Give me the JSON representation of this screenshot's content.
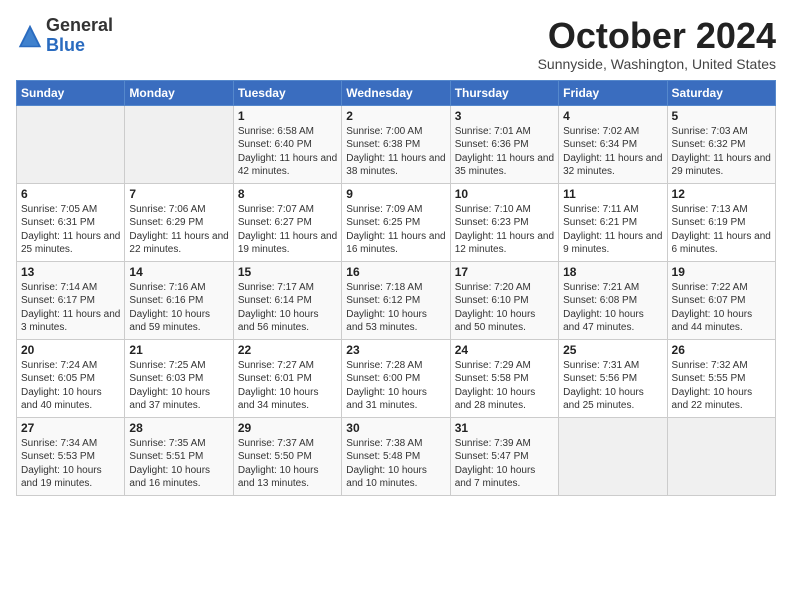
{
  "header": {
    "logo_general": "General",
    "logo_blue": "Blue",
    "month_title": "October 2024",
    "subtitle": "Sunnyside, Washington, United States"
  },
  "days_of_week": [
    "Sunday",
    "Monday",
    "Tuesday",
    "Wednesday",
    "Thursday",
    "Friday",
    "Saturday"
  ],
  "weeks": [
    [
      {
        "day": "",
        "info": ""
      },
      {
        "day": "",
        "info": ""
      },
      {
        "day": "1",
        "info": "Sunrise: 6:58 AM\nSunset: 6:40 PM\nDaylight: 11 hours and 42 minutes."
      },
      {
        "day": "2",
        "info": "Sunrise: 7:00 AM\nSunset: 6:38 PM\nDaylight: 11 hours and 38 minutes."
      },
      {
        "day": "3",
        "info": "Sunrise: 7:01 AM\nSunset: 6:36 PM\nDaylight: 11 hours and 35 minutes."
      },
      {
        "day": "4",
        "info": "Sunrise: 7:02 AM\nSunset: 6:34 PM\nDaylight: 11 hours and 32 minutes."
      },
      {
        "day": "5",
        "info": "Sunrise: 7:03 AM\nSunset: 6:32 PM\nDaylight: 11 hours and 29 minutes."
      }
    ],
    [
      {
        "day": "6",
        "info": "Sunrise: 7:05 AM\nSunset: 6:31 PM\nDaylight: 11 hours and 25 minutes."
      },
      {
        "day": "7",
        "info": "Sunrise: 7:06 AM\nSunset: 6:29 PM\nDaylight: 11 hours and 22 minutes."
      },
      {
        "day": "8",
        "info": "Sunrise: 7:07 AM\nSunset: 6:27 PM\nDaylight: 11 hours and 19 minutes."
      },
      {
        "day": "9",
        "info": "Sunrise: 7:09 AM\nSunset: 6:25 PM\nDaylight: 11 hours and 16 minutes."
      },
      {
        "day": "10",
        "info": "Sunrise: 7:10 AM\nSunset: 6:23 PM\nDaylight: 11 hours and 12 minutes."
      },
      {
        "day": "11",
        "info": "Sunrise: 7:11 AM\nSunset: 6:21 PM\nDaylight: 11 hours and 9 minutes."
      },
      {
        "day": "12",
        "info": "Sunrise: 7:13 AM\nSunset: 6:19 PM\nDaylight: 11 hours and 6 minutes."
      }
    ],
    [
      {
        "day": "13",
        "info": "Sunrise: 7:14 AM\nSunset: 6:17 PM\nDaylight: 11 hours and 3 minutes."
      },
      {
        "day": "14",
        "info": "Sunrise: 7:16 AM\nSunset: 6:16 PM\nDaylight: 10 hours and 59 minutes."
      },
      {
        "day": "15",
        "info": "Sunrise: 7:17 AM\nSunset: 6:14 PM\nDaylight: 10 hours and 56 minutes."
      },
      {
        "day": "16",
        "info": "Sunrise: 7:18 AM\nSunset: 6:12 PM\nDaylight: 10 hours and 53 minutes."
      },
      {
        "day": "17",
        "info": "Sunrise: 7:20 AM\nSunset: 6:10 PM\nDaylight: 10 hours and 50 minutes."
      },
      {
        "day": "18",
        "info": "Sunrise: 7:21 AM\nSunset: 6:08 PM\nDaylight: 10 hours and 47 minutes."
      },
      {
        "day": "19",
        "info": "Sunrise: 7:22 AM\nSunset: 6:07 PM\nDaylight: 10 hours and 44 minutes."
      }
    ],
    [
      {
        "day": "20",
        "info": "Sunrise: 7:24 AM\nSunset: 6:05 PM\nDaylight: 10 hours and 40 minutes."
      },
      {
        "day": "21",
        "info": "Sunrise: 7:25 AM\nSunset: 6:03 PM\nDaylight: 10 hours and 37 minutes."
      },
      {
        "day": "22",
        "info": "Sunrise: 7:27 AM\nSunset: 6:01 PM\nDaylight: 10 hours and 34 minutes."
      },
      {
        "day": "23",
        "info": "Sunrise: 7:28 AM\nSunset: 6:00 PM\nDaylight: 10 hours and 31 minutes."
      },
      {
        "day": "24",
        "info": "Sunrise: 7:29 AM\nSunset: 5:58 PM\nDaylight: 10 hours and 28 minutes."
      },
      {
        "day": "25",
        "info": "Sunrise: 7:31 AM\nSunset: 5:56 PM\nDaylight: 10 hours and 25 minutes."
      },
      {
        "day": "26",
        "info": "Sunrise: 7:32 AM\nSunset: 5:55 PM\nDaylight: 10 hours and 22 minutes."
      }
    ],
    [
      {
        "day": "27",
        "info": "Sunrise: 7:34 AM\nSunset: 5:53 PM\nDaylight: 10 hours and 19 minutes."
      },
      {
        "day": "28",
        "info": "Sunrise: 7:35 AM\nSunset: 5:51 PM\nDaylight: 10 hours and 16 minutes."
      },
      {
        "day": "29",
        "info": "Sunrise: 7:37 AM\nSunset: 5:50 PM\nDaylight: 10 hours and 13 minutes."
      },
      {
        "day": "30",
        "info": "Sunrise: 7:38 AM\nSunset: 5:48 PM\nDaylight: 10 hours and 10 minutes."
      },
      {
        "day": "31",
        "info": "Sunrise: 7:39 AM\nSunset: 5:47 PM\nDaylight: 10 hours and 7 minutes."
      },
      {
        "day": "",
        "info": ""
      },
      {
        "day": "",
        "info": ""
      }
    ]
  ]
}
